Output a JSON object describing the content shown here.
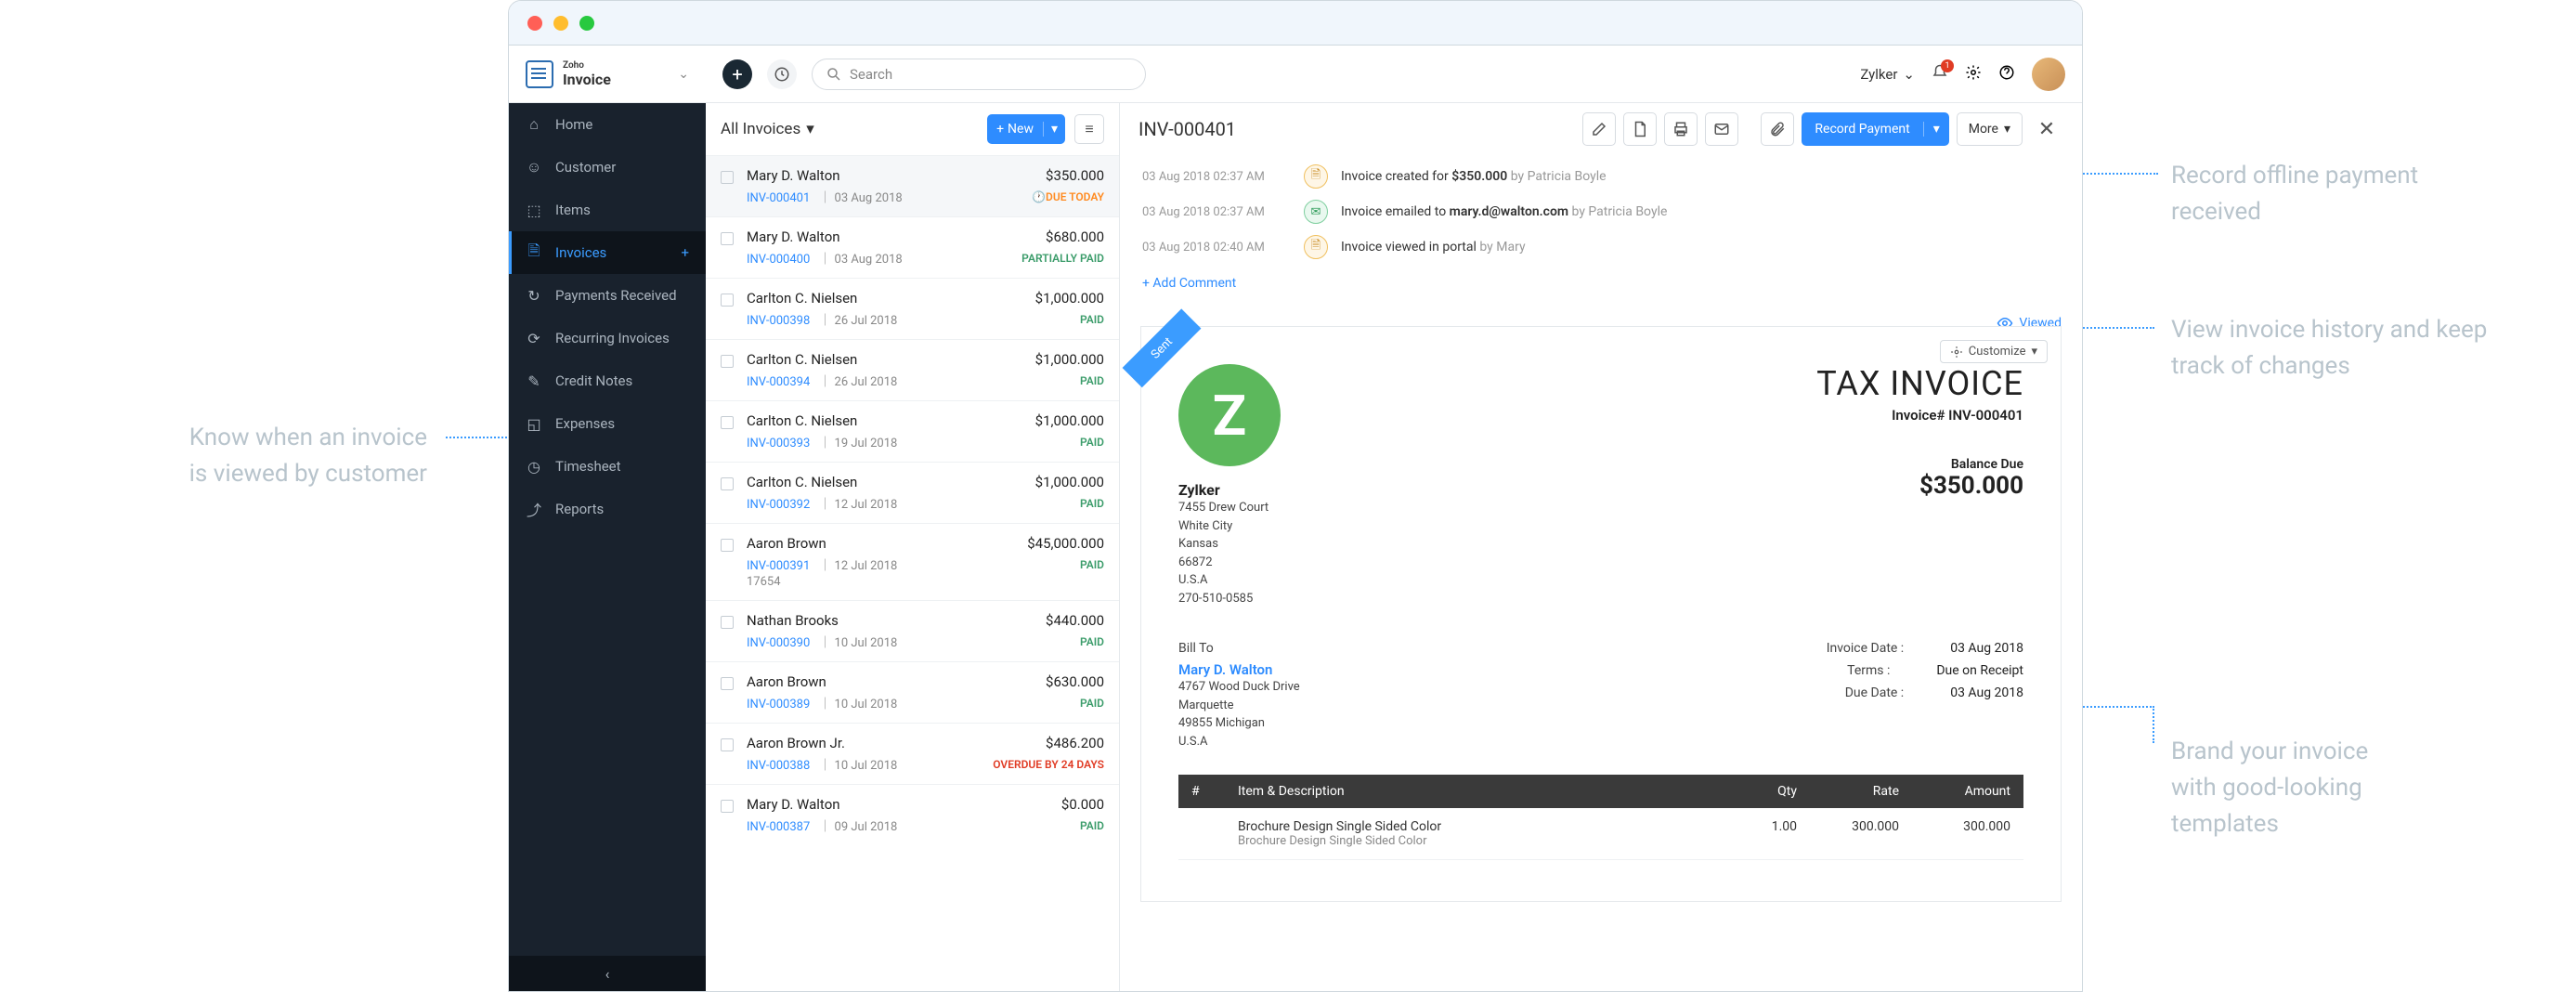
{
  "annotations": {
    "left1": "Know when an invoice\nis viewed by customer",
    "right1": "Record offline payment\nreceived",
    "right2": "View invoice history and keep\ntrack of changes",
    "right3": "Brand your invoice\nwith good-looking\ntemplates"
  },
  "brand": {
    "top": "Zoho",
    "bottom": "Invoice"
  },
  "search": {
    "placeholder": "Search"
  },
  "org": {
    "name": "Zylker"
  },
  "bell_count": "1",
  "sidebar": {
    "items": [
      {
        "icon": "home",
        "label": "Home"
      },
      {
        "icon": "user",
        "label": "Customer"
      },
      {
        "icon": "box",
        "label": "Items"
      },
      {
        "icon": "file",
        "label": "Invoices",
        "active": true,
        "plus": true
      },
      {
        "icon": "rotate",
        "label": "Payments Received"
      },
      {
        "icon": "repeat",
        "label": "Recurring Invoices"
      },
      {
        "icon": "note",
        "label": "Credit Notes"
      },
      {
        "icon": "wallet",
        "label": "Expenses"
      },
      {
        "icon": "clock",
        "label": "Timesheet"
      },
      {
        "icon": "chart",
        "label": "Reports"
      }
    ]
  },
  "list": {
    "title": "All Invoices",
    "new_label": "New",
    "rows": [
      {
        "name": "Mary D. Walton",
        "amount": "$350.000",
        "id": "INV-000401",
        "date": "03 Aug 2018",
        "status": "DUE TODAY",
        "stclass": "st-due",
        "sel": true,
        "clock": true
      },
      {
        "name": "Mary D. Walton",
        "amount": "$680.000",
        "id": "INV-000400",
        "date": "03 Aug 2018",
        "status": "PARTIALLY PAID",
        "stclass": "st-partial"
      },
      {
        "name": "Carlton C. Nielsen",
        "amount": "$1,000.000",
        "id": "INV-000398",
        "date": "26 Jul 2018",
        "status": "PAID",
        "stclass": "st-paid"
      },
      {
        "name": "Carlton C. Nielsen",
        "amount": "$1,000.000",
        "id": "INV-000394",
        "date": "26 Jul 2018",
        "status": "PAID",
        "stclass": "st-paid"
      },
      {
        "name": "Carlton C. Nielsen",
        "amount": "$1,000.000",
        "id": "INV-000393",
        "date": "19 Jul 2018",
        "status": "PAID",
        "stclass": "st-paid"
      },
      {
        "name": "Carlton C. Nielsen",
        "amount": "$1,000.000",
        "id": "INV-000392",
        "date": "12 Jul 2018",
        "status": "PAID",
        "stclass": "st-paid"
      },
      {
        "name": "Aaron Brown",
        "amount": "$45,000.000",
        "id": "INV-000391",
        "date": "12 Jul 2018",
        "status": "PAID",
        "stclass": "st-paid",
        "ref": "17654"
      },
      {
        "name": "Nathan Brooks",
        "amount": "$440.000",
        "id": "INV-000390",
        "date": "10 Jul 2018",
        "status": "PAID",
        "stclass": "st-paid"
      },
      {
        "name": "Aaron Brown",
        "amount": "$630.000",
        "id": "INV-000389",
        "date": "10 Jul 2018",
        "status": "PAID",
        "stclass": "st-paid"
      },
      {
        "name": "Aaron Brown Jr.",
        "amount": "$486.200",
        "id": "INV-000388",
        "date": "10 Jul 2018",
        "status": "OVERDUE BY 24 DAYS",
        "stclass": "st-over"
      },
      {
        "name": "Mary D. Walton",
        "amount": "$0.000",
        "id": "INV-000387",
        "date": "09 Jul 2018",
        "status": "PAID",
        "stclass": "st-paid"
      }
    ]
  },
  "detail": {
    "title": "INV-000401",
    "record_label": "Record Payment",
    "more_label": "More",
    "viewed_label": "Viewed",
    "customize_label": "Customize",
    "sent_label": "Sent",
    "add_comment": "+ Add Comment",
    "history": [
      {
        "time": "03 Aug 2018 02:37 AM",
        "icon": "y",
        "pre": "Invoice created for ",
        "bold": "$350.000",
        "by": "by Patricia Boyle"
      },
      {
        "time": "03 Aug 2018 02:37 AM",
        "icon": "g",
        "pre": "Invoice emailed to ",
        "bold": "mary.d@walton.com",
        "by": "by Patricia Boyle"
      },
      {
        "time": "03 Aug 2018 02:40 AM",
        "icon": "y",
        "pre": "Invoice viewed in portal ",
        "bold": "",
        "by": "by Mary"
      }
    ],
    "company": {
      "name": "Zylker",
      "lines": [
        "7455 Drew Court",
        "White City",
        "Kansas",
        "66872",
        "U.S.A",
        "270-510-0585"
      ]
    },
    "paper_title": "TAX INVOICE",
    "inv_no_label": "Invoice# INV-000401",
    "balance_due_label": "Balance Due",
    "balance_due_value": "$350.000",
    "billto_label": "Bill To",
    "billto": {
      "name": "Mary D. Walton",
      "lines": [
        "4767 Wood Duck Drive",
        "Marquette",
        "49855 Michigan",
        "U.S.A"
      ]
    },
    "meta": [
      {
        "label": "Invoice Date :",
        "value": "03 Aug 2018"
      },
      {
        "label": "Terms :",
        "value": "Due on Receipt"
      },
      {
        "label": "Due Date :",
        "value": "03 Aug 2018"
      }
    ],
    "table": {
      "headers": [
        "#",
        "Item & Description",
        "Qty",
        "Rate",
        "Amount"
      ],
      "rows": [
        {
          "n": "",
          "item": "Brochure Design Single Sided Color",
          "desc": "Brochure Design Single Sided Color",
          "qty": "1.00",
          "rate": "300.000",
          "amount": "300.000"
        }
      ]
    }
  },
  "icons": {
    "home": "⌂",
    "user": "👤",
    "box": "◳",
    "file": "🗎",
    "rotate": "↻",
    "repeat": "⟳",
    "note": "✎",
    "wallet": "◱",
    "clock": "◷",
    "chart": "📈"
  }
}
